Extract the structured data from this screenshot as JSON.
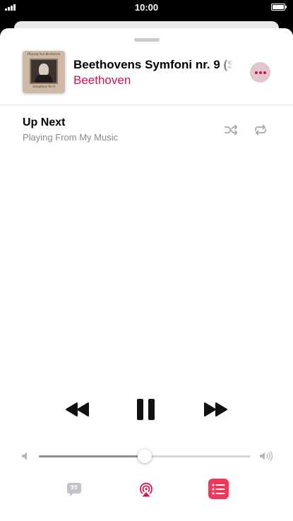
{
  "status_bar": {
    "time": "10:00"
  },
  "now_playing": {
    "title": "Beethovens Symfoni nr. 9 (S",
    "artist": "Beethoven",
    "artwork_text_top": "Playing Von Beethoven",
    "artwork_text_bottom": "Symphony No 9",
    "more_icon": "ellipsis-icon"
  },
  "up_next": {
    "title": "Up Next",
    "subtitle": "Playing From My Music",
    "shuffle_icon": "shuffle-icon",
    "repeat_icon": "repeat-icon"
  },
  "controls": {
    "rewind_icon": "rewind-icon",
    "pause_icon": "pause-icon",
    "forward_icon": "fast-forward-icon"
  },
  "volume": {
    "level": 0.5
  },
  "bottom_bar": {
    "lyrics_icon": "lyrics-icon",
    "airplay_icon": "airplay-icon",
    "queue_icon": "queue-list-icon"
  },
  "colors": {
    "accent": "#d8104f",
    "queue_button": "#f2375a",
    "inactive_icon": "#bcbcc0",
    "secondary_text": "#8a8a8e"
  }
}
